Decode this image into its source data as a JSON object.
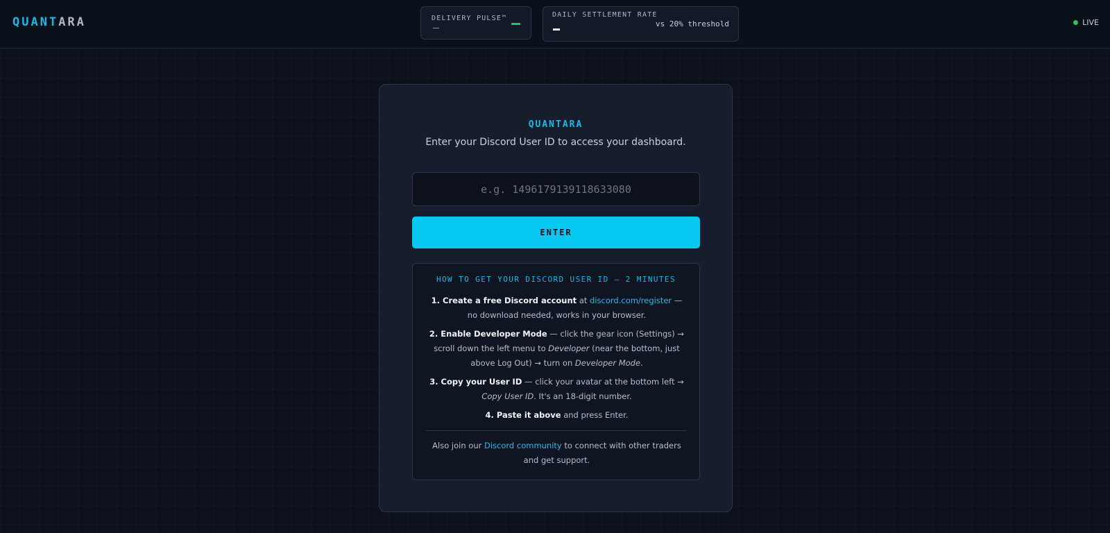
{
  "header": {
    "logo_part1": "QUANT",
    "logo_part2": "ARA",
    "delivery_pulse": {
      "label": "DELIVERY PULSE™"
    },
    "daily_settlement": {
      "label": "DAILY SETTLEMENT RATE",
      "sub": "vs 20% threshold"
    },
    "live_label": "LIVE"
  },
  "colors": {
    "accent": "#06c8f0",
    "live": "#22c55e",
    "background": "#0c111b",
    "card": "#161e2d"
  },
  "login": {
    "title": "QUANTARA",
    "subtitle": "Enter your Discord User ID to access your dashboard.",
    "input_placeholder": "e.g. 1496179139118633080",
    "input_value": "",
    "enter_label": "ENTER"
  },
  "guide": {
    "title": "HOW TO GET YOUR DISCORD USER ID — 2 MINUTES",
    "step1": {
      "bold": "1. Create a free Discord account",
      "pre": " at ",
      "link": "discord.com/register",
      "post": " — no download needed, works in your browser."
    },
    "step2": {
      "bold": "2. Enable Developer Mode",
      "t1": " — click the gear icon (Settings) → scroll down the left menu to ",
      "i1": "Developer",
      "t2": " (near the bottom, just above Log Out) → turn on ",
      "i2": "Developer Mode",
      "t3": "."
    },
    "step3": {
      "bold": "3. Copy your User ID",
      "t1": " — click your avatar at the bottom left → ",
      "i1": "Copy User ID",
      "t2": ". It's an 18-digit number."
    },
    "step4": {
      "bold": "4. Paste it above",
      "t1": " and press Enter."
    },
    "footer": {
      "pre": "Also join our ",
      "link": "Discord community",
      "post": " to connect with other traders and get support."
    }
  }
}
